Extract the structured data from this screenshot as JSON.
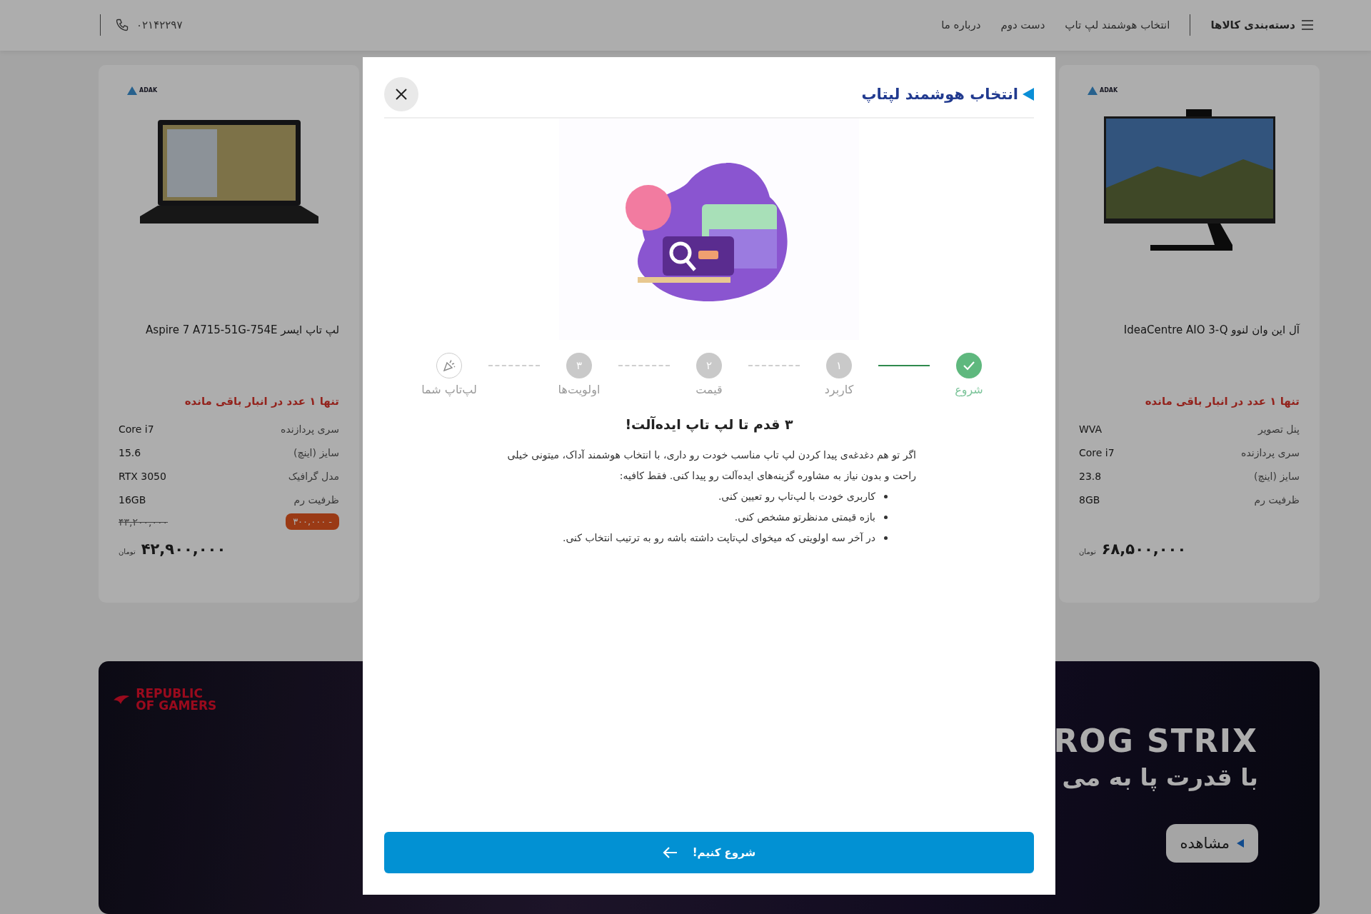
{
  "header": {
    "categories": "دسته‌بندی کالاها",
    "nav": [
      "انتخاب هوشمند لپ تاپ",
      "دست دوم",
      "درباره ما"
    ],
    "phone": "۰۲۱۴۲۲۹۷"
  },
  "products": [
    {
      "kind": "monitor",
      "logo": "ADAK",
      "title": "آل این وان لنوو IdeaCentre AIO 3-Q",
      "stock": "تنها ۱ عدد در انبار باقی مانده",
      "specs": [
        {
          "label": "پنل تصویر",
          "value": "WVA"
        },
        {
          "label": "سری پردازنده",
          "value": "Core i7"
        },
        {
          "label": "سایز (اینچ)",
          "value": "23.8"
        },
        {
          "label": "ظرفیت رم",
          "value": "8GB"
        }
      ],
      "price": "۶۸,۵۰۰,۰۰۰",
      "currency": "تومان"
    },
    {
      "kind": "laptop",
      "logo": "ADAK",
      "title": "لپ تاپ ایسر Aspire 7 A715-51G-754E",
      "stock": "تنها ۱ عدد در انبار باقی مانده",
      "specs": [
        {
          "label": "سری پردازنده",
          "value": "Core i7"
        },
        {
          "label": "سایز (اینچ)",
          "value": "15.6"
        },
        {
          "label": "مدل گرافیک",
          "value": "RTX 3050"
        },
        {
          "label": "ظرفیت رم",
          "value": "16GB"
        }
      ],
      "old_price": "۴۳,۲۰۰,۰۰۰",
      "discount": "- ۳۰۰,۰۰۰",
      "price": "۴۲,۹۰۰,۰۰۰",
      "currency": "تومان"
    }
  ],
  "banner": {
    "brand": "REPUBLIC OF GAMERS",
    "title": "ROG STRIX",
    "subtitle": "با قدرت پا به می",
    "button": "مشاهده"
  },
  "modal": {
    "title": "انتخاب هوشمند لپتاپ",
    "steps": [
      {
        "label": "شروع",
        "kind": "check",
        "done": true
      },
      {
        "label": "کاربرد",
        "kind": "number",
        "number": "۱",
        "done": false
      },
      {
        "label": "قیمت",
        "kind": "number",
        "number": "۲",
        "done": false
      },
      {
        "label": "اولویت‌ها",
        "kind": "number",
        "number": "۳",
        "done": false
      },
      {
        "label": "لپ‌تاپ شما",
        "kind": "final",
        "done": false
      }
    ],
    "heading": "۳ قدم تا لپ تاپ ایده‌آلت!",
    "intro": "اگر تو هم دغدغه‌ی پیدا کردن لپ تاپ مناسب خودت رو داری، با انتخاب هوشمند آداک، میتونی خیلی راحت و بدون نیاز به مشاوره گزینه‌های ایده‌آلت رو پیدا کنی. فقط کافیه:",
    "bullets": [
      "کاربری خودت با لپ‌تاپ رو تعیین کنی.",
      "بازه قیمتی مدنظرتو مشخص کنی.",
      "در آخر سه اولویتی که میخوای لپ‌تاپت داشته باشه رو به ترتیب انتخاب کنی."
    ],
    "button": "شروع کنیم!"
  }
}
